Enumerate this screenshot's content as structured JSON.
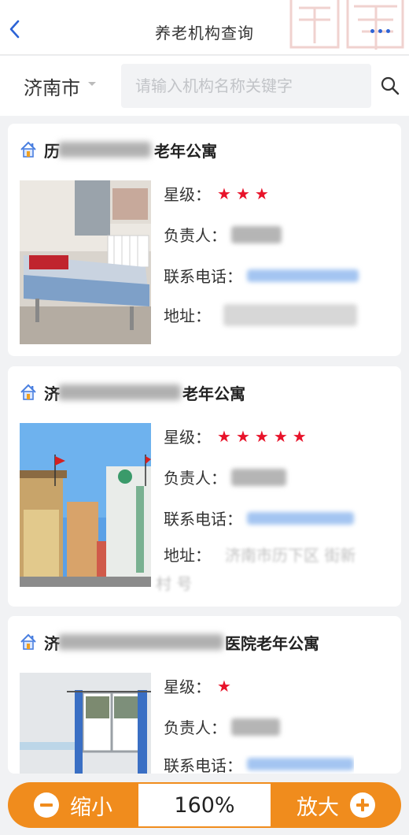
{
  "nav": {
    "title": "养老机构查询",
    "back_icon": "chevron-left-icon",
    "more_icon": "more-dots-icon",
    "accent": "#2c63d6"
  },
  "search": {
    "city": "济南市",
    "placeholder": "请输入机构名称关键字",
    "value": ""
  },
  "cards": [
    {
      "name_visible": "历",
      "name_suffix": "老年公寓",
      "star_label": "星级：",
      "stars": 3,
      "manager_label": "负责人：",
      "phone_label": "联系电话：",
      "address_label": "地址："
    },
    {
      "name_visible": "济",
      "name_suffix": "老年公寓",
      "star_label": "星级：",
      "stars": 5,
      "manager_label": "负责人：",
      "phone_label": "联系电话：",
      "address_label": "地址：",
      "address_line1": "济南市历下区 街新",
      "address_line2": "村  号"
    },
    {
      "name_visible": "济",
      "name_suffix": "医院老年公寓",
      "star_label": "星级：",
      "stars": 1,
      "manager_label": "负责人：",
      "phone_label": "联系电话："
    }
  ],
  "zoom": {
    "out_label": "缩小",
    "level": "160%",
    "in_label": "放大",
    "color": "#f08c1d"
  },
  "star_color": "#e8132a"
}
